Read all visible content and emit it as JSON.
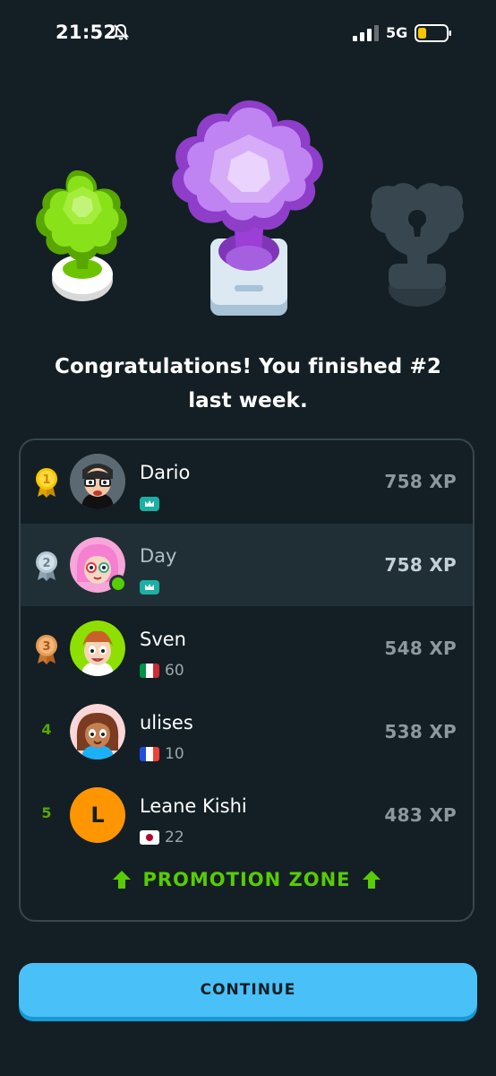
{
  "status_bar": {
    "time": "21:52",
    "network": "5G"
  },
  "headline": {
    "line1": "Congratulations! You finished #2",
    "line2": "last week."
  },
  "leaderboard": [
    {
      "rank": "1",
      "name": "Dario",
      "xp": "758 XP",
      "flag": "crown",
      "count": "",
      "medal": "gold"
    },
    {
      "rank": "2",
      "name": "Day",
      "xp": "758 XP",
      "flag": "crown",
      "count": "",
      "medal": "silver"
    },
    {
      "rank": "3",
      "name": "Sven",
      "xp": "548 XP",
      "flag": "italy",
      "count": "60",
      "medal": "bronze"
    },
    {
      "rank": "4",
      "name": "ulises",
      "xp": "538 XP",
      "flag": "france",
      "count": "10",
      "medal": ""
    },
    {
      "rank": "5",
      "name": "Leane Kishi",
      "xp": "483 XP",
      "flag": "japan",
      "count": "22",
      "medal": "",
      "initial": "L"
    }
  ],
  "promotion_zone": {
    "label": "PROMOTION ZONE"
  },
  "continue_button": {
    "label": "CONTINUE"
  },
  "colors": {
    "background": "#131f24",
    "accent_green": "#58cc02",
    "button_blue": "#49c0f8"
  }
}
